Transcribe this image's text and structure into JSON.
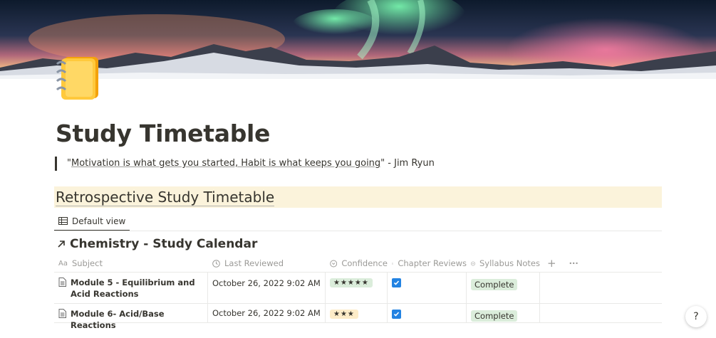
{
  "page": {
    "title": "Study Timetable",
    "icon": "notebook-icon",
    "quote_open": "\"",
    "quote_linked": "Motivation is what gets you started, Habit is what keeps you going",
    "quote_close": "\" - Jim Ryun"
  },
  "section": {
    "heading": "Retrospective Study Timetable",
    "view_tab": "Default view"
  },
  "database": {
    "title": "Chemistry - Study Calendar",
    "columns": [
      "Subject",
      "Last Reviewed",
      "Confidence",
      "Chapter Reviews",
      "Syllabus Notes"
    ],
    "add_column": "+",
    "more": "···",
    "rows": [
      {
        "subject": "Module 5 - Equilibrium and Acid Reactions",
        "last_reviewed": "October 26, 2022 9:02 AM",
        "confidence": "★★★★★",
        "chapter_reviews_checked": true,
        "syllabus_notes": "Complete"
      },
      {
        "subject": "Module 6- Acid/Base Reactions",
        "last_reviewed": "October 26, 2022 9:02 AM",
        "confidence": "★★★",
        "chapter_reviews_checked": true,
        "syllabus_notes": "Complete"
      }
    ]
  },
  "help_label": "?",
  "colors": {
    "heading_bg": "#fbf3db",
    "tag_green": "#dbeddb",
    "tag_yellow": "#fdecc8",
    "checkbox_blue": "#2383e2"
  }
}
